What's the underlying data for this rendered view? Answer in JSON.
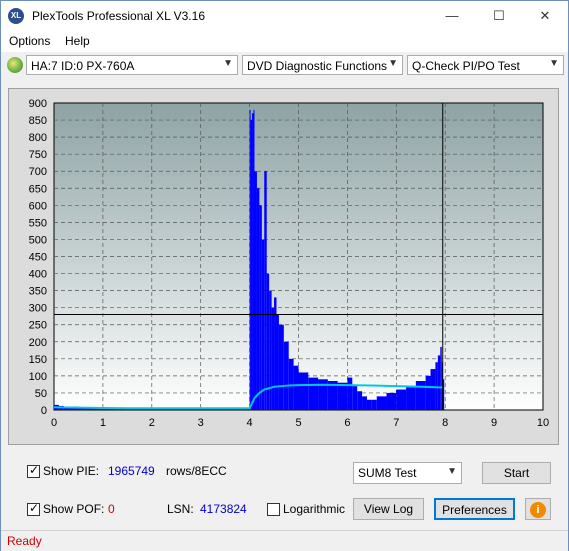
{
  "window": {
    "title": "PlexTools Professional XL V3.16",
    "app_icon_text": "XL"
  },
  "titlebar_buttons": {
    "minimize": "—",
    "maximize": "☐",
    "close": "✕"
  },
  "menu": [
    {
      "label": "Options"
    },
    {
      "label": "Help"
    }
  ],
  "toolbar": {
    "drive": "HA:7 ID:0  PX-760A",
    "function": "DVD Diagnostic Functions",
    "test": "Q-Check PI/PO Test"
  },
  "chart_data": {
    "type": "bar",
    "xlim": [
      0,
      10
    ],
    "ylim": [
      0,
      900
    ],
    "x_ticks": [
      "0",
      "1",
      "2",
      "3",
      "4",
      "5",
      "6",
      "7",
      "8",
      "9",
      "10"
    ],
    "y_ticks": [
      "0",
      "50",
      "100",
      "150",
      "200",
      "250",
      "300",
      "350",
      "400",
      "450",
      "500",
      "550",
      "600",
      "650",
      "700",
      "750",
      "800",
      "850",
      "900"
    ],
    "grid": true,
    "threshold_y": 280,
    "data_end_x": 7.95,
    "colors": {
      "bars": "#0000ff",
      "line": "#00c8e6",
      "plot_bg_top": "#8ea3a5",
      "plot_bg_bottom": "#ffffff"
    },
    "series": [
      {
        "type": "bar",
        "x": [
          0.0,
          0.1,
          0.2,
          0.5,
          1.0,
          1.5,
          2.0,
          2.5,
          3.0,
          3.5,
          3.95,
          4.0,
          4.02,
          4.05,
          4.08,
          4.1,
          4.15,
          4.2,
          4.25,
          4.3,
          4.35,
          4.4,
          4.45,
          4.5,
          4.55,
          4.6,
          4.7,
          4.8,
          4.9,
          5.0,
          5.2,
          5.4,
          5.6,
          5.8,
          6.0,
          6.1,
          6.2,
          6.3,
          6.4,
          6.5,
          6.6,
          6.8,
          7.0,
          7.2,
          7.4,
          7.6,
          7.7,
          7.8,
          7.85,
          7.9,
          7.93,
          7.95
        ],
        "values": [
          15,
          12,
          10,
          8,
          6,
          5,
          4,
          3,
          3,
          3,
          3,
          880,
          850,
          870,
          880,
          700,
          650,
          600,
          500,
          700,
          400,
          350,
          300,
          330,
          280,
          250,
          200,
          150,
          130,
          110,
          95,
          90,
          85,
          80,
          95,
          70,
          55,
          40,
          30,
          30,
          40,
          50,
          60,
          70,
          85,
          100,
          120,
          140,
          160,
          185,
          140,
          90
        ]
      },
      {
        "type": "line",
        "x": [
          0.0,
          0.5,
          1.0,
          1.5,
          2.0,
          2.5,
          3.0,
          3.5,
          4.0,
          4.05,
          4.1,
          4.2,
          4.3,
          4.5,
          4.8,
          5.0,
          5.5,
          6.0,
          6.5,
          7.0,
          7.5,
          7.95
        ],
        "values": [
          8,
          7,
          6,
          5,
          5,
          5,
          5,
          5,
          5,
          20,
          35,
          50,
          60,
          68,
          72,
          73,
          74,
          73,
          72,
          70,
          68,
          66
        ]
      }
    ]
  },
  "bottom": {
    "show_pie_label": "Show PIE:",
    "show_pie_checked": true,
    "pie_value": "1965749",
    "pie_unit": "rows/8ECC",
    "show_pof_label": "Show POF:",
    "show_pof_checked": true,
    "pof_value": "0",
    "lsn_label": "LSN:",
    "lsn_value": "4173824",
    "logarithmic_label": "Logarithmic",
    "logarithmic_checked": false,
    "test_select": "SUM8 Test",
    "start_label": "Start",
    "view_log_label": "View Log",
    "preferences_label": "Preferences",
    "info_icon": "i",
    "checkmark": "✓"
  },
  "status": {
    "text": "Ready"
  }
}
